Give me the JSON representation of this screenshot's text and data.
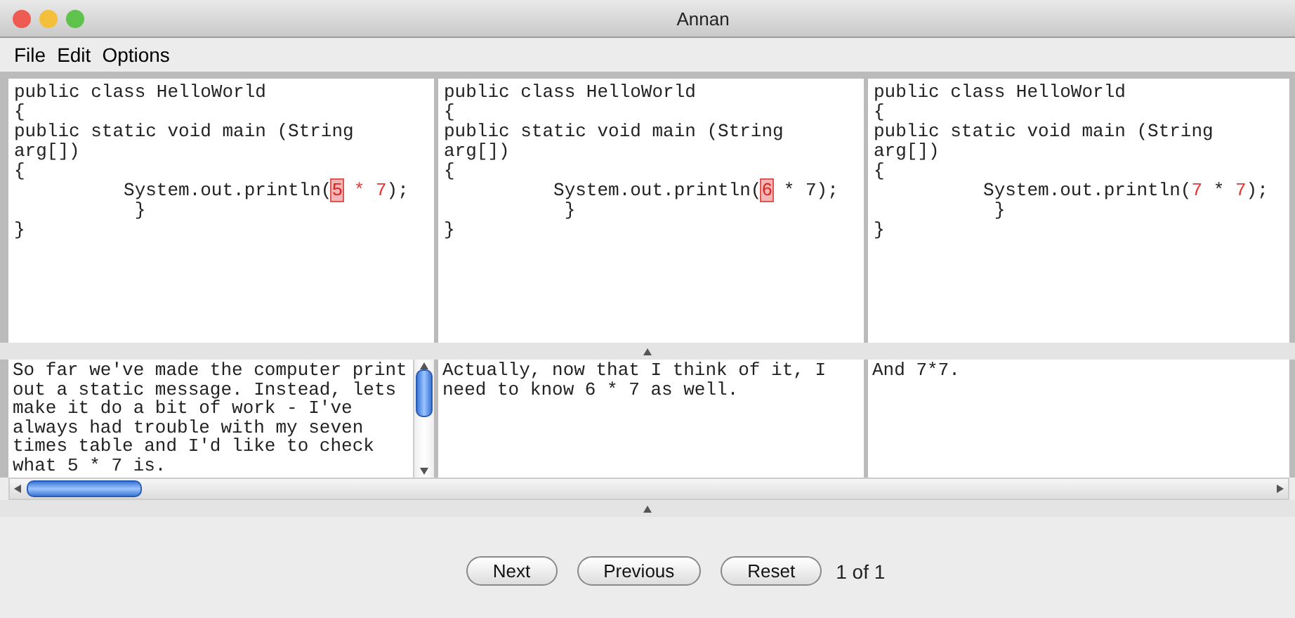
{
  "window": {
    "title": "Annan"
  },
  "menu": [
    "File",
    "Edit",
    "Options"
  ],
  "code_panes": [
    {
      "lines": [
        {
          "text": "public class HelloWorld"
        },
        {
          "text": "{"
        },
        {
          "text": "public static void main (String"
        },
        {
          "text": "arg[])"
        },
        {
          "text": "{"
        },
        {
          "segments": [
            {
              "text": "          System.out.println(",
              "kind": "plain"
            },
            {
              "text": "5",
              "kind": "selected"
            },
            {
              "text": " * 7",
              "kind": "changed"
            },
            {
              "text": ");",
              "kind": "plain"
            }
          ]
        },
        {
          "text": "           }"
        },
        {
          "text": "}"
        }
      ]
    },
    {
      "lines": [
        {
          "text": "public class HelloWorld"
        },
        {
          "text": "{"
        },
        {
          "text": "public static void main (String"
        },
        {
          "text": "arg[])"
        },
        {
          "text": "{"
        },
        {
          "segments": [
            {
              "text": "          System.out.println(",
              "kind": "plain"
            },
            {
              "text": "6",
              "kind": "selected"
            },
            {
              "text": " * 7);",
              "kind": "plain"
            }
          ]
        },
        {
          "text": "           }"
        },
        {
          "text": "}"
        }
      ]
    },
    {
      "lines": [
        {
          "text": "public class HelloWorld"
        },
        {
          "text": "{"
        },
        {
          "text": "public static void main (String"
        },
        {
          "text": "arg[])"
        },
        {
          "text": "{"
        },
        {
          "segments": [
            {
              "text": "          System.out.println(",
              "kind": "plain"
            },
            {
              "text": "7",
              "kind": "changed"
            },
            {
              "text": " * ",
              "kind": "plain"
            },
            {
              "text": "7",
              "kind": "changed"
            },
            {
              "text": ");",
              "kind": "plain"
            }
          ]
        },
        {
          "text": "           }"
        },
        {
          "text": "}"
        }
      ]
    }
  ],
  "note_panes": [
    {
      "text": "So far we've made the computer print out a static message. Instead, lets make it do a bit of work - I've always had trouble with my seven times table and I'd like to check what 5 * 7 is.",
      "scrollbar": true
    },
    {
      "text": "Actually, now that I think of it, I need to know 6 * 7 as well.",
      "scrollbar": false
    },
    {
      "text": "And 7*7.",
      "scrollbar": false
    }
  ],
  "buttons": [
    "Next",
    "Previous",
    "Reset"
  ],
  "page_indicator": "1 of 1"
}
